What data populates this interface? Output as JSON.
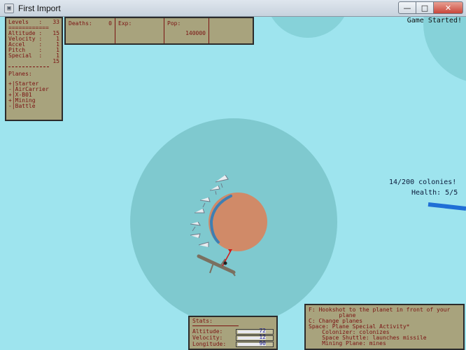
{
  "window": {
    "title": "First Import",
    "icon": "app-icon",
    "min": "—",
    "max": "□",
    "close": "✕"
  },
  "stats": {
    "levels_label": "Levels",
    "levels_value": "33",
    "separator": "============",
    "rows": [
      {
        "label": "Altitude",
        "value": "15"
      },
      {
        "label": "Velocity",
        "value": "1"
      },
      {
        "label": "Accel",
        "value": "1"
      },
      {
        "label": "Pitch",
        "value": "1"
      },
      {
        "label": "Special",
        "value": "1"
      }
    ],
    "total": "15",
    "planes_label": "Planes:",
    "planes": [
      "+|Starter",
      "-|AirCarrier",
      "+|X-B01",
      "+|Mining",
      "-|Battle"
    ]
  },
  "top_bar": {
    "deaths_label": "Deaths:",
    "deaths_value": "0",
    "exp_label": "Exp:",
    "pop_label": "Pop:",
    "pop_value": "140000"
  },
  "bottom_stats": {
    "title": "Stats:",
    "rows": [
      {
        "label": "Altitude:",
        "value": "72"
      },
      {
        "label": "Velocity:",
        "value": "12"
      },
      {
        "label": "Longitude:",
        "value": "90"
      }
    ]
  },
  "help": {
    "lines": [
      "F: Hookshot to the planet in front of your",
      "         plane",
      "C: Change planes",
      "",
      "Space: Plane Special Activity*",
      "    Colonizer: colonizes",
      "    Space Shuttle: launches missile",
      "    Mining Plane: mines"
    ]
  },
  "hud": {
    "game_started": "Game Started!",
    "colonies": "14/200 colonies!",
    "health": "Health: 5/5"
  },
  "colors": {
    "sky": "#9ee4ee",
    "atmosphere": "#7fc9cf",
    "planet": "#d08a68",
    "panel": "#a8a37d",
    "panel_text": "#7a1212",
    "trail": "#3e7fb3",
    "health_bar": "#1f6fd6"
  }
}
